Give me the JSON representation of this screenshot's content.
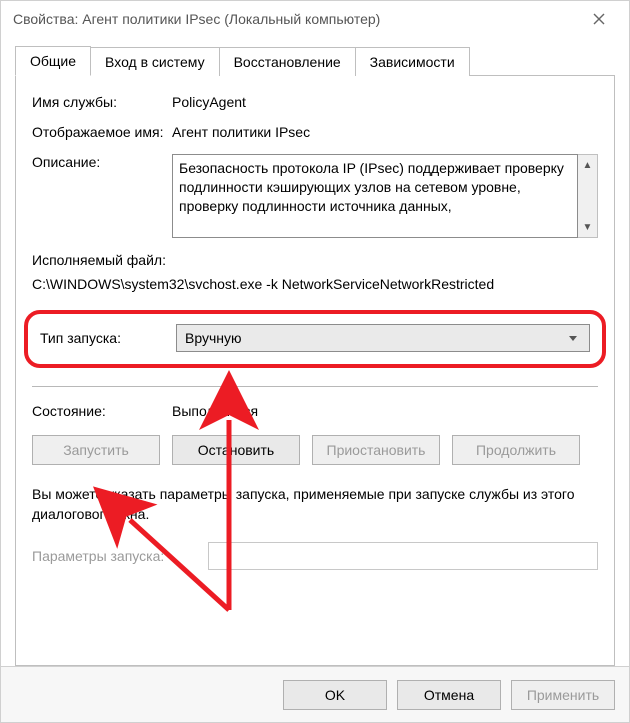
{
  "titlebar": {
    "title": "Свойства: Агент политики IPsec (Локальный компьютер)"
  },
  "tabs": {
    "general": "Общие",
    "logon": "Вход в систему",
    "recovery": "Восстановление",
    "dependencies": "Зависимости"
  },
  "fields": {
    "service_name_label": "Имя службы:",
    "service_name_value": "PolicyAgent",
    "display_name_label": "Отображаемое имя:",
    "display_name_value": "Агент политики IPsec",
    "description_label": "Описание:",
    "description_value": "Безопасность протокола IP (IPsec) поддерживает проверку подлинности кэширующих узлов на сетевом уровне, проверку подлинности источника данных,",
    "exe_label": "Исполняемый файл:",
    "exe_path": "C:\\WINDOWS\\system32\\svchost.exe -k NetworkServiceNetworkRestricted",
    "startup_type_label": "Тип запуска:",
    "startup_type_value": "Вручную",
    "status_label": "Состояние:",
    "status_value": "Выполняется",
    "hint": "Вы можете указать параметры запуска, применяемые при запуске службы из этого диалогового окна.",
    "params_label": "Параметры запуска:"
  },
  "buttons": {
    "start": "Запустить",
    "stop": "Остановить",
    "pause": "Приостановить",
    "resume": "Продолжить",
    "ok": "OK",
    "cancel": "Отмена",
    "apply": "Применить"
  }
}
